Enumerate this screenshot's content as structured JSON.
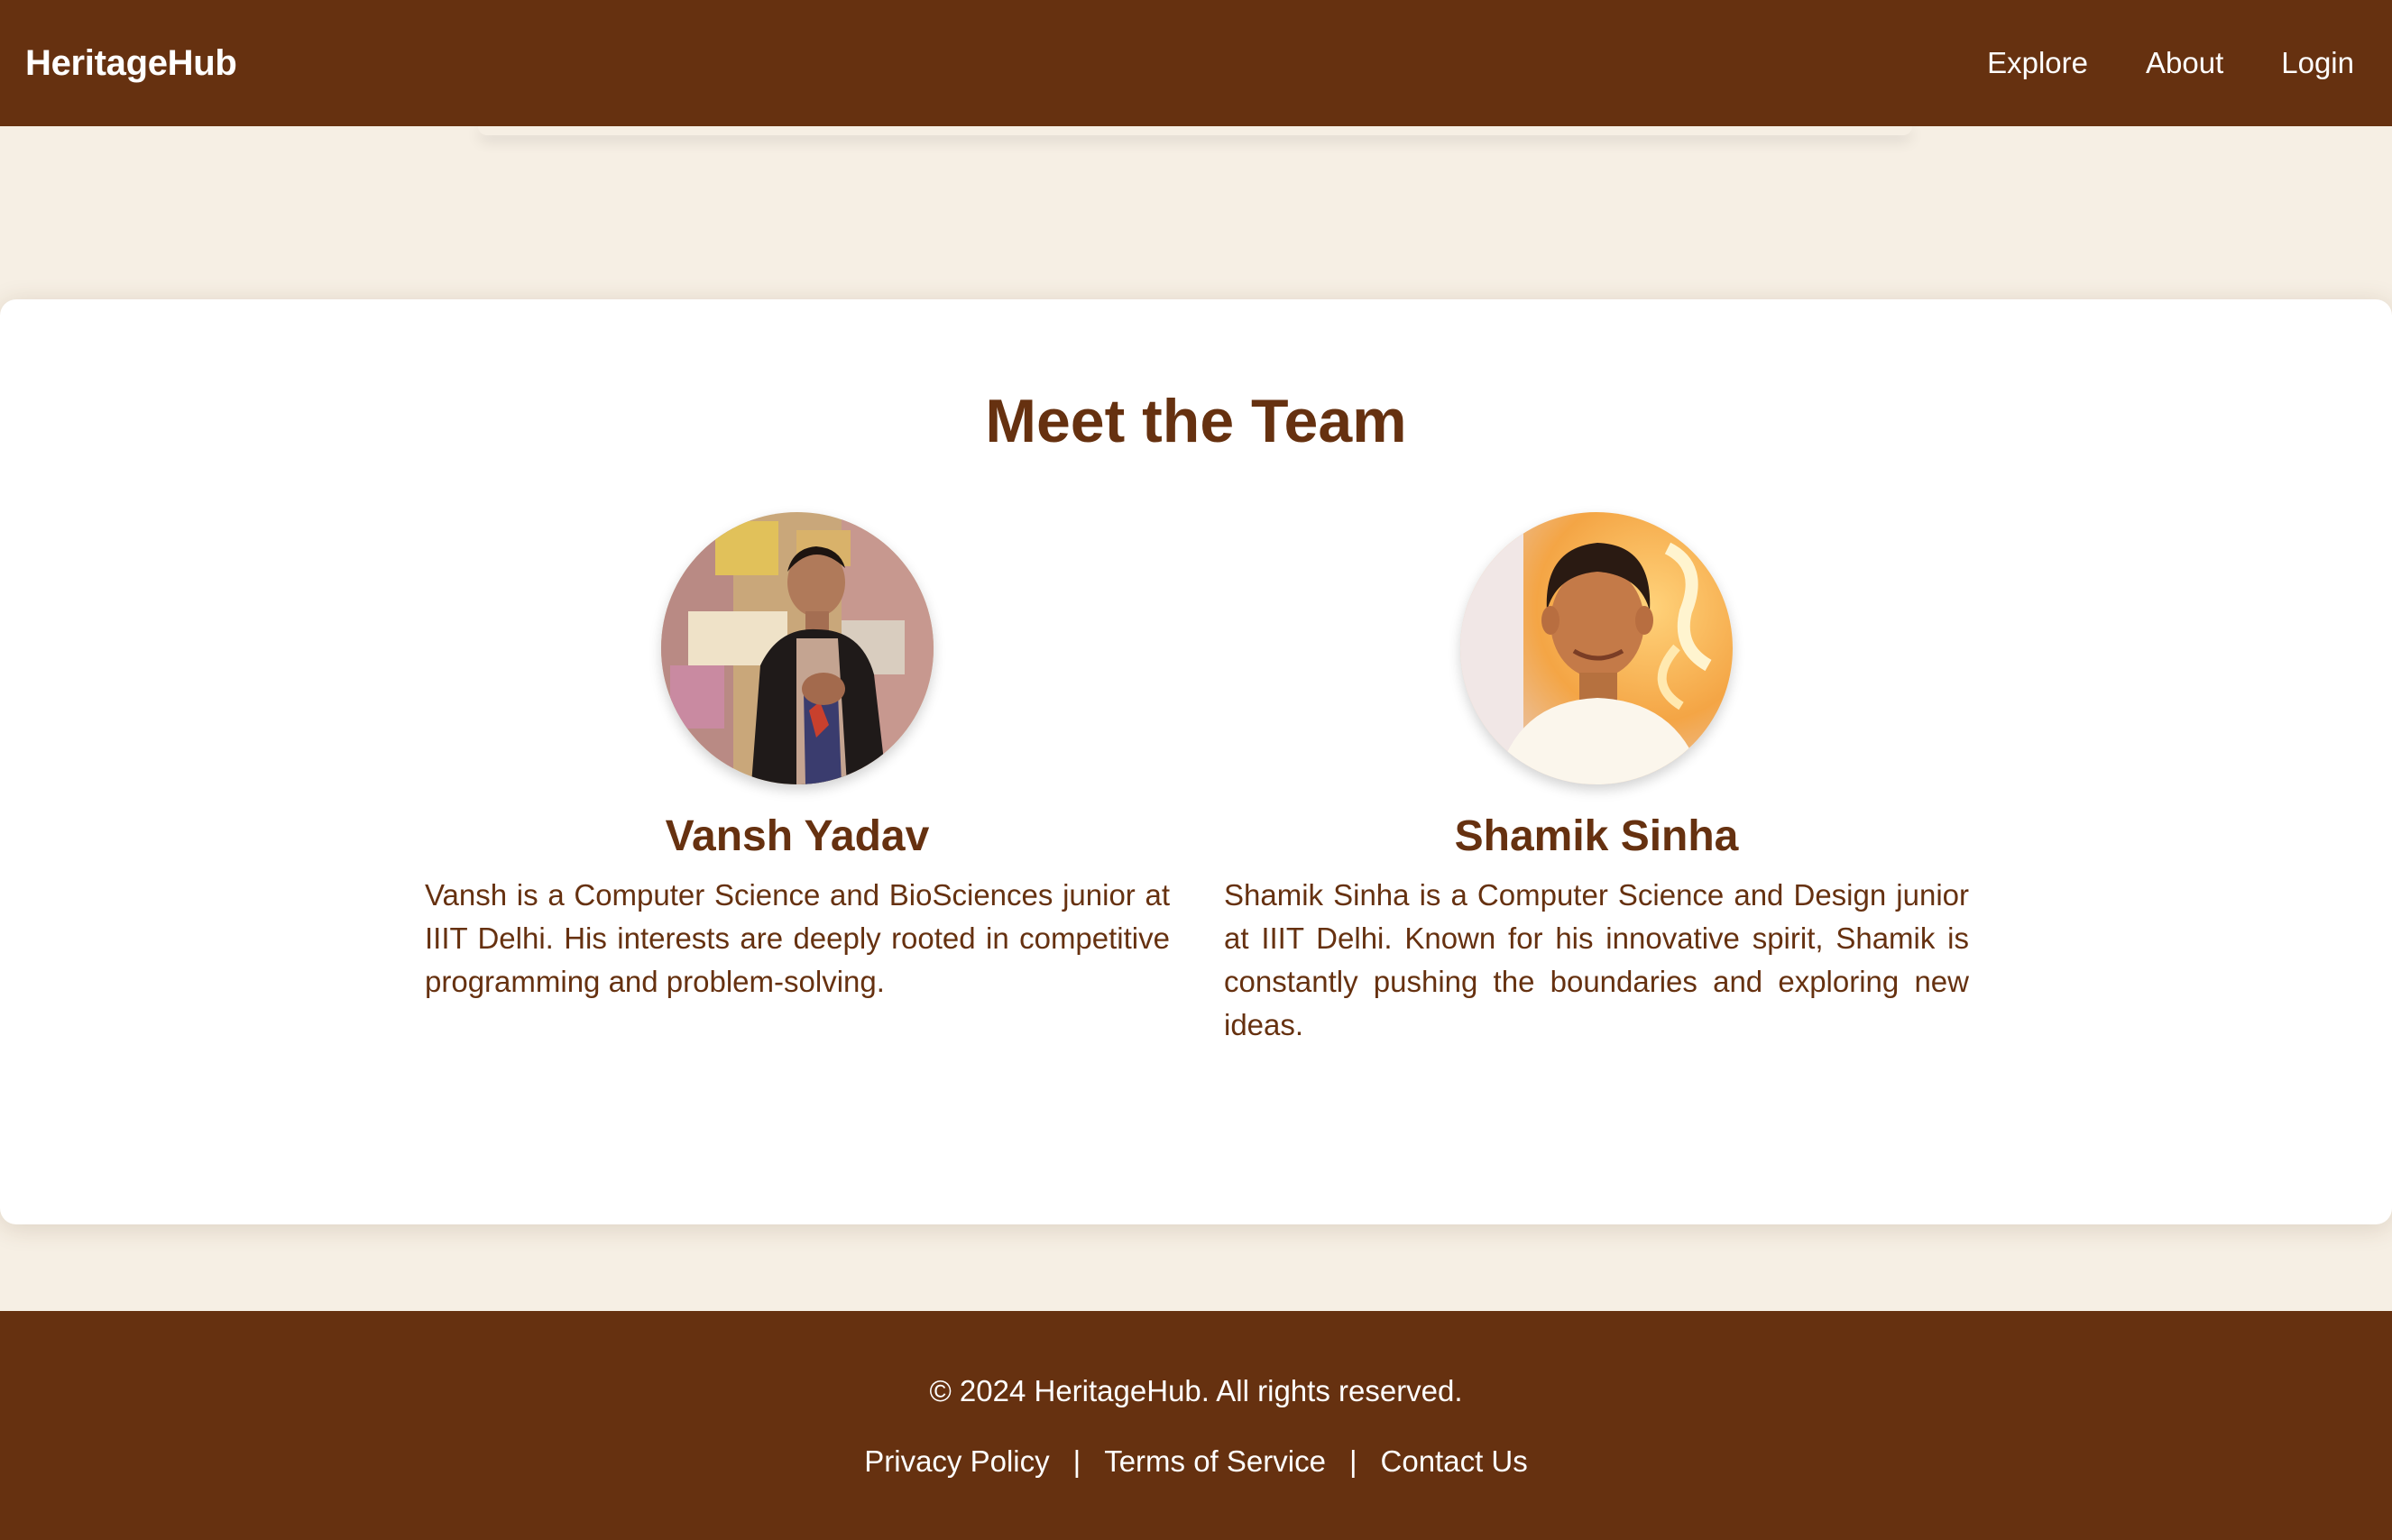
{
  "nav": {
    "brand": "HeritageHub",
    "links": [
      "Explore",
      "About",
      "Login"
    ]
  },
  "team": {
    "title": "Meet the Team",
    "members": [
      {
        "name": "Vansh Yadav",
        "bio": "Vansh is a Computer Science and BioSciences junior at IIIT Delhi. His interests are deeply rooted in competitive programming and problem-solving."
      },
      {
        "name": "Shamik Sinha",
        "bio": "Shamik Sinha is a Computer Science and Design junior at IIIT Delhi. Known for his innovative spirit, Shamik is constantly pushing the boundaries and exploring new ideas."
      }
    ]
  },
  "footer": {
    "copyright": "© 2024 HeritageHub. All rights reserved.",
    "links": [
      "Privacy Policy",
      "Terms of Service",
      "Contact Us"
    ],
    "separator": "|"
  },
  "colors": {
    "brand_brown": "#663110",
    "page_background": "#f6efe4",
    "card_background": "#ffffff"
  }
}
